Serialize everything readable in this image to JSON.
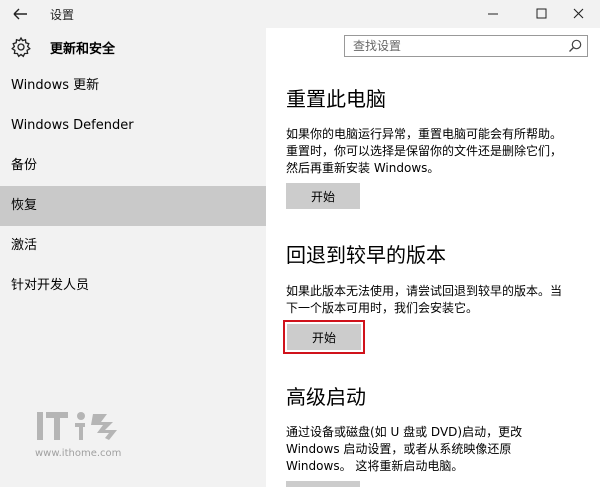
{
  "titlebar": {
    "app_title": "设置"
  },
  "sidebar": {
    "section_title": "更新和安全",
    "items": [
      {
        "label": "Windows 更新",
        "active": false
      },
      {
        "label": "Windows Defender",
        "active": false
      },
      {
        "label": "备份",
        "active": false
      },
      {
        "label": "恢复",
        "active": true
      },
      {
        "label": "激活",
        "active": false
      },
      {
        "label": "针对开发人员",
        "active": false
      }
    ]
  },
  "search": {
    "placeholder": "查找设置"
  },
  "main": {
    "reset": {
      "title": "重置此电脑",
      "desc_lines": [
        "如果你的电脑运行异常，重置电脑可能会有所帮助。",
        "重置时，你可以选择是保留你的文件还是删除它们，",
        "然后再重新安装 Windows。"
      ],
      "button": "开始"
    },
    "rollback": {
      "title": "回退到较早的版本",
      "desc_lines": [
        "如果此版本无法使用，请尝试回退到较早的版本。当",
        "下一个版本可用时，我们会安装它。"
      ],
      "button": "开始"
    },
    "advanced": {
      "title": "高级启动",
      "desc_lines": [
        "通过设备或磁盘(如 U 盘或 DVD)启动，更改",
        "Windows 启动设置，或者从系统映像还原",
        "Windows。 这将重新启动电脑。"
      ]
    }
  },
  "watermark": {
    "url": "www.ithome.com"
  },
  "colors": {
    "sidebar_bg": "#f2f2f2",
    "active_item_bg": "#c9c9c9",
    "button_bg": "#cccccc",
    "highlight_border": "#d0121b"
  }
}
